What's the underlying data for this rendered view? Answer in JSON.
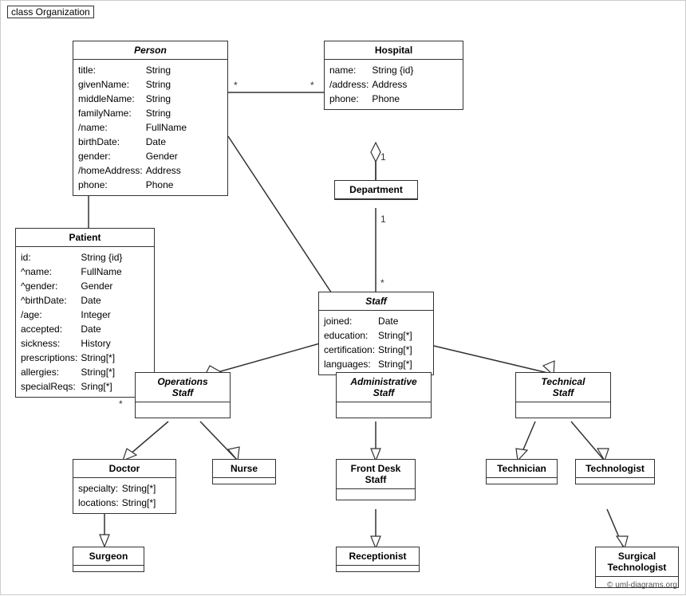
{
  "diagram": {
    "title": "class Organization",
    "copyright": "© uml-diagrams.org",
    "classes": {
      "person": {
        "name": "Person",
        "italic": true,
        "attrs": [
          [
            "title:",
            "String"
          ],
          [
            "givenName:",
            "String"
          ],
          [
            "middleName:",
            "String"
          ],
          [
            "familyName:",
            "String"
          ],
          [
            "/name:",
            "FullName"
          ],
          [
            "birthDate:",
            "Date"
          ],
          [
            "gender:",
            "Gender"
          ],
          [
            "/homeAddress:",
            "Address"
          ],
          [
            "phone:",
            "Phone"
          ]
        ]
      },
      "hospital": {
        "name": "Hospital",
        "italic": false,
        "attrs": [
          [
            "name:",
            "String {id}"
          ],
          [
            "/address:",
            "Address"
          ],
          [
            "phone:",
            "Phone"
          ]
        ]
      },
      "patient": {
        "name": "Patient",
        "italic": false,
        "attrs": [
          [
            "id:",
            "String {id}"
          ],
          [
            "^name:",
            "FullName"
          ],
          [
            "^gender:",
            "Gender"
          ],
          [
            "^birthDate:",
            "Date"
          ],
          [
            "/age:",
            "Integer"
          ],
          [
            "accepted:",
            "Date"
          ],
          [
            "sickness:",
            "History"
          ],
          [
            "prescriptions:",
            "String[*]"
          ],
          [
            "allergies:",
            "String[*]"
          ],
          [
            "specialReqs:",
            "Sring[*]"
          ]
        ]
      },
      "department": {
        "name": "Department",
        "italic": false,
        "attrs": []
      },
      "staff": {
        "name": "Staff",
        "italic": true,
        "attrs": [
          [
            "joined:",
            "Date"
          ],
          [
            "education:",
            "String[*]"
          ],
          [
            "certification:",
            "String[*]"
          ],
          [
            "languages:",
            "String[*]"
          ]
        ]
      },
      "operations_staff": {
        "name": "Operations\nStaff",
        "italic": true,
        "attrs": []
      },
      "administrative_staff": {
        "name": "Administrative\nStaff",
        "italic": true,
        "attrs": []
      },
      "technical_staff": {
        "name": "Technical\nStaff",
        "italic": true,
        "attrs": []
      },
      "doctor": {
        "name": "Doctor",
        "italic": false,
        "attrs": [
          [
            "specialty:",
            "String[*]"
          ],
          [
            "locations:",
            "String[*]"
          ]
        ]
      },
      "nurse": {
        "name": "Nurse",
        "italic": false,
        "attrs": []
      },
      "front_desk_staff": {
        "name": "Front Desk\nStaff",
        "italic": false,
        "attrs": []
      },
      "technician": {
        "name": "Technician",
        "italic": false,
        "attrs": []
      },
      "technologist": {
        "name": "Technologist",
        "italic": false,
        "attrs": []
      },
      "surgeon": {
        "name": "Surgeon",
        "italic": false,
        "attrs": []
      },
      "receptionist": {
        "name": "Receptionist",
        "italic": false,
        "attrs": []
      },
      "surgical_technologist": {
        "name": "Surgical\nTechnologist",
        "italic": false,
        "attrs": []
      }
    }
  }
}
